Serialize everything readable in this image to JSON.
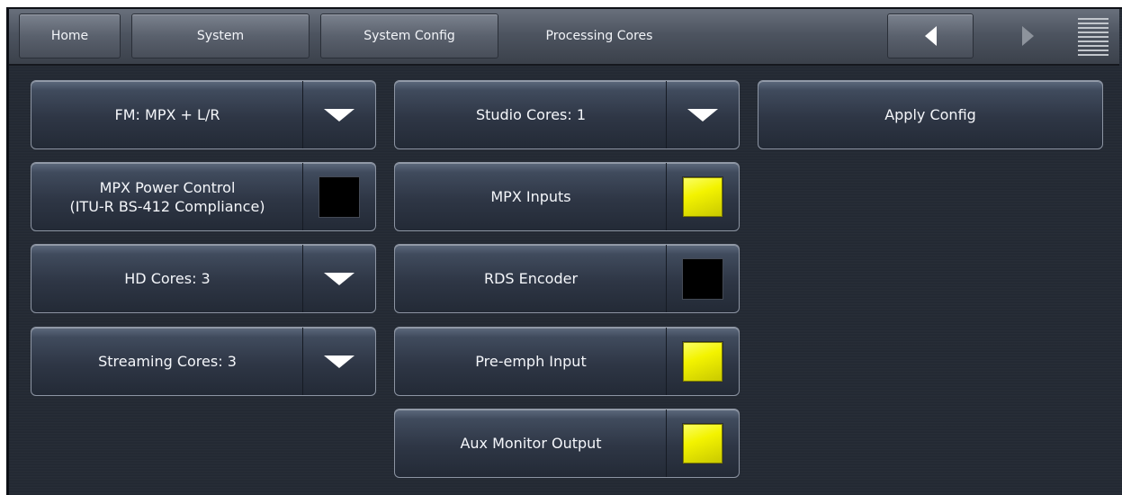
{
  "nav": {
    "tabs": [
      "Home",
      "System",
      "System Config",
      "Processing Cores"
    ],
    "back_icon": "triangle-left",
    "forward_icon": "triangle-right",
    "menu_icon": "hamburger-lines"
  },
  "left_column": {
    "fm_mode": "FM: MPX + L/R",
    "mpx_power_line1": "MPX Power Control",
    "mpx_power_line2": "(ITU-R BS-412 Compliance)",
    "hd_cores": "HD Cores: 3",
    "streaming_cores": "Streaming Cores: 3"
  },
  "middle_column": {
    "studio_cores": "Studio Cores: 1",
    "mpx_inputs": "MPX Inputs",
    "rds_encoder": "RDS Encoder",
    "pre_emph_input": "Pre-emph Input",
    "aux_monitor_output": "Aux Monitor Output"
  },
  "right_column": {
    "apply_config": "Apply Config"
  },
  "states": {
    "mpx_power_control": false,
    "mpx_inputs": true,
    "rds_encoder": false,
    "pre_emph_input": true,
    "aux_monitor_output": true
  },
  "colors": {
    "indicator_on": "#f3f300",
    "indicator_off": "#000000",
    "background": "#232933"
  }
}
